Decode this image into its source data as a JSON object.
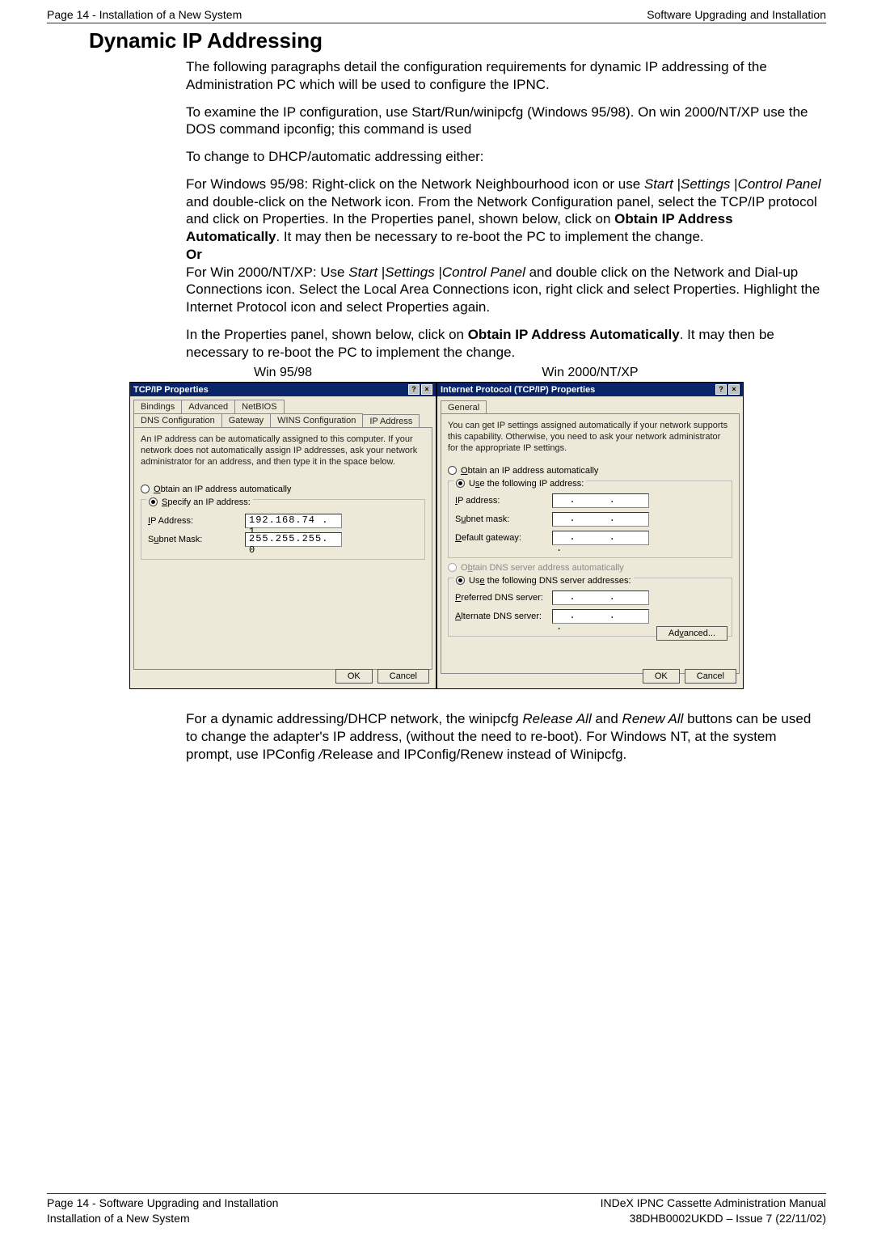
{
  "header": {
    "left": "Page 14 - Installation of a New System",
    "right": "Software Upgrading and Installation"
  },
  "title": "Dynamic IP Addressing",
  "p1": "The following paragraphs detail the configuration requirements for dynamic IP addressing of the Administration PC which will be used to configure the IPNC.",
  "p2": "To examine the IP configuration, use Start/Run/winipcfg (Windows 95/98). On win 2000/NT/XP use the DOS command ipconfig; this command is used",
  "p3": "To change to DHCP/automatic addressing either:",
  "p4a_prefix": "For Windows 95/98: Right-click on the Network Neighbourhood icon or use ",
  "p4a_start": "Start",
  "p4a_pipe1": " |",
  "p4a_settings": "Settings",
  "p4a_pipe2": " |",
  "p4a_cp": "Control Panel",
  "p4a_mid": " and double-click on the Network icon. From the Network Configuration panel, select the TCP/IP protocol and click on Properties. In the Properties panel, shown below, click on ",
  "p4a_bold": "Obtain IP Address Automatically",
  "p4a_end": ". It may then be necessary to re-boot the PC to implement the change.",
  "or": "Or",
  "p4b_prefix": "For Win 2000/NT/XP: Use ",
  "p4b_start": "Start",
  "p4b_pipe1": " |",
  "p4b_settings": "Settings",
  "p4b_pipe2": " |",
  "p4b_cp": "Control Panel",
  "p4b_end": " and double click on the Network and Dial-up Connections icon. Select the Local Area Connections icon, right click and select Properties. Highlight the Internet Protocol icon and select Properties again.",
  "p5_prefix": "In the Properties panel, shown below, click on ",
  "p5_bold1": "Obtain IP Address Automatically",
  "p5_end": ". It may then be necessary to re-boot the PC to implement the change.",
  "wintitles": {
    "left": "Win 95/98",
    "right": "Win 2000/NT/XP"
  },
  "dlg9598": {
    "title": "TCP/IP Properties",
    "tabs_row1": [
      "Bindings",
      "Advanced",
      "NetBIOS"
    ],
    "tabs_row2": [
      "DNS Configuration",
      "Gateway",
      "WINS Configuration",
      "IP Address"
    ],
    "intro": "An IP address can be automatically assigned to this computer. If your network does not automatically assign IP addresses, ask your network administrator for an address, and then type it in the space below.",
    "radio_auto": "Obtain an IP address automatically",
    "radio_spec": "Specify an IP address:",
    "ip_label": "IP Address:",
    "ip_value": "192.168.74 . 1",
    "mask_label": "Subnet Mask:",
    "mask_value": "255.255.255. 0",
    "ok": "OK",
    "cancel": "Cancel"
  },
  "dlg2000": {
    "title": "Internet Protocol (TCP/IP) Properties",
    "tab": "General",
    "intro": "You can get IP settings assigned automatically if your network supports this capability. Otherwise, you need to ask your network administrator for the appropriate IP settings.",
    "radio_auto": "Obtain an IP address automatically",
    "radio_spec": "Use the following IP address:",
    "ip_label": "IP address:",
    "mask_label": "Subnet mask:",
    "gw_label": "Default gateway:",
    "radio_dns_auto": "Obtain DNS server address automatically",
    "radio_dns_spec": "Use the following DNS server addresses:",
    "pref_dns": "Preferred DNS server:",
    "alt_dns": "Alternate DNS server:",
    "advanced": "Advanced...",
    "ok": "OK",
    "cancel": "Cancel"
  },
  "p6_prefix": "For a dynamic addressing/DHCP network, the winipcfg ",
  "p6_rel": "Release All",
  "p6_and": " and ",
  "p6_ren": "Renew All",
  "p6_mid": " buttons can be used to change the adapter's IP address, (without the need to re-boot). For Windows NT, at the system prompt, use IPConfig ",
  "p6_slash": "/",
  "p6_end": "Release and IPConfig/Renew instead of Winipcfg.",
  "footer": {
    "left1": "Page 14 - Software Upgrading and Installation",
    "left2": "Installation of a New System",
    "right1": "INDeX IPNC Cassette Administration Manual",
    "right2": "38DHB0002UKDD – Issue 7 (22/11/02)"
  }
}
